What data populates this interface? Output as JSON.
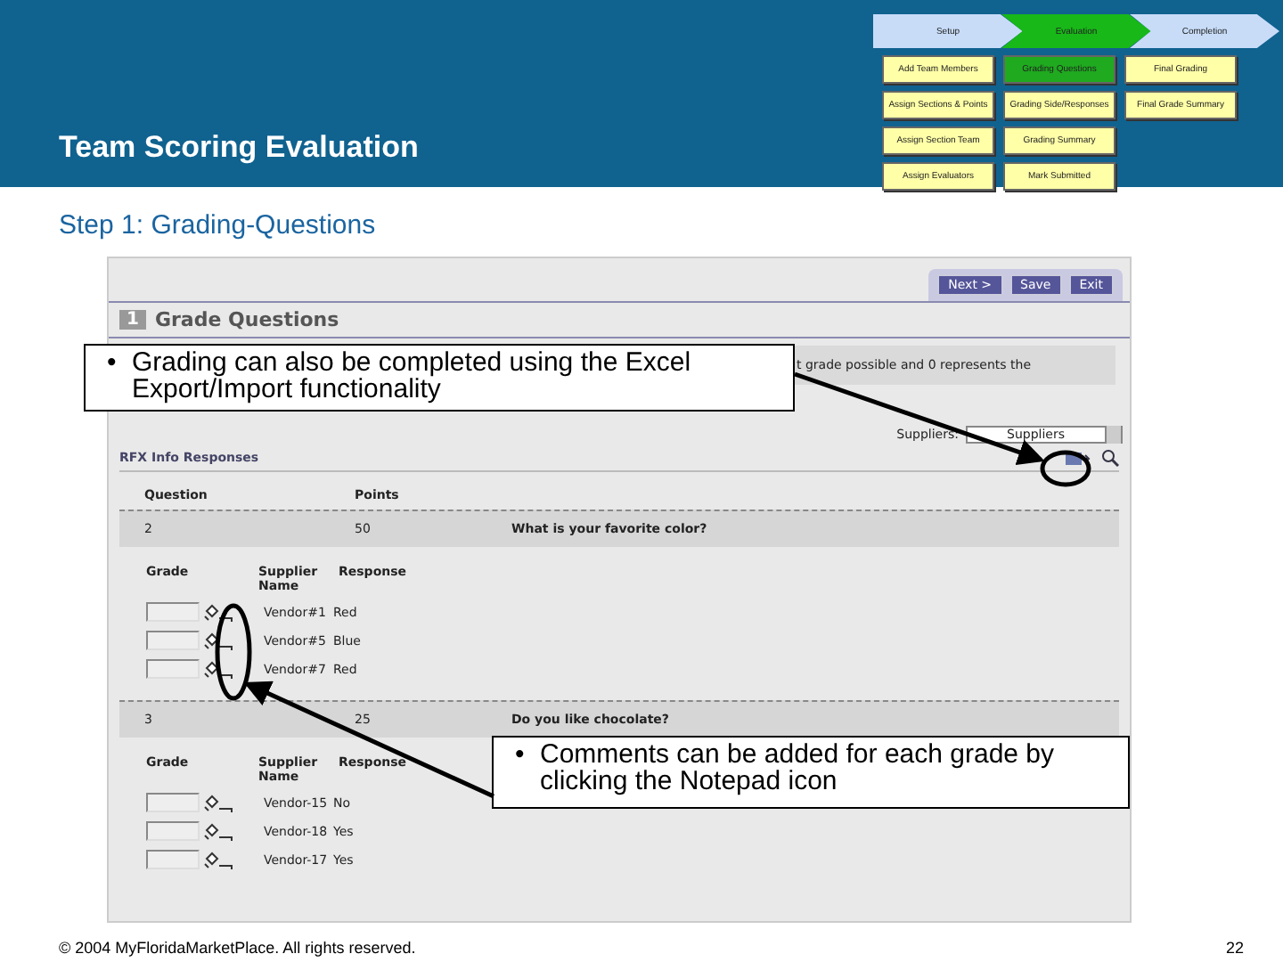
{
  "header": {
    "title": "Team Scoring Evaluation"
  },
  "process": {
    "phases": [
      {
        "label": "Setup",
        "selected": false,
        "steps": [
          {
            "label": "Add Team Members",
            "selected": false
          },
          {
            "label": "Assign Sections & Points",
            "selected": false
          },
          {
            "label": "Assign Section Team",
            "selected": false
          },
          {
            "label": "Assign Evaluators",
            "selected": false
          }
        ]
      },
      {
        "label": "Evaluation",
        "selected": true,
        "steps": [
          {
            "label": "Grading Questions",
            "selected": true
          },
          {
            "label": "Grading Side/Responses",
            "selected": false
          },
          {
            "label": "Grading Summary",
            "selected": false
          },
          {
            "label": "Mark Submitted",
            "selected": false
          }
        ]
      },
      {
        "label": "Completion",
        "selected": false,
        "steps": [
          {
            "label": "Final Grading",
            "selected": false
          },
          {
            "label": "Final Grade Summary",
            "selected": false
          }
        ]
      }
    ]
  },
  "step_title": "Step 1: Grading-Questions",
  "screen": {
    "buttons": [
      "Next >",
      "Save",
      "Exit"
    ],
    "section_number": "1",
    "section_title": "Grade Questions",
    "info": "t grade possible and 0 represents the",
    "filter": {
      "label": "Suppliers:",
      "value": "Suppliers"
    },
    "list_title": "RFX Info Responses",
    "columns": [
      "Question",
      "Points"
    ],
    "questions": [
      {
        "number": "2",
        "points": "50",
        "text": "What is your favorite color?",
        "grade_columns": [
          "Grade",
          "Supplier Name",
          "Response"
        ],
        "responses": [
          {
            "supplier": "Vendor#1",
            "response": "Red"
          },
          {
            "supplier": "Vendor#5",
            "response": "Blue"
          },
          {
            "supplier": "Vendor#7",
            "response": "Red"
          }
        ]
      },
      {
        "number": "3",
        "points": "25",
        "text": "Do you like chocolate?",
        "grade_columns": [
          "Grade",
          "Supplier Name",
          "Response"
        ],
        "responses": [
          {
            "supplier": "Vendor-15",
            "response": "No"
          },
          {
            "supplier": "Vendor-18",
            "response": "Yes"
          },
          {
            "supplier": "Vendor-17",
            "response": "Yes"
          }
        ]
      }
    ]
  },
  "callouts": [
    {
      "bullet": "•",
      "text": "Grading can also be completed using the Excel Export/Import functionality"
    },
    {
      "bullet": "•",
      "text": "Comments can be added for each grade by clicking the Notepad icon"
    }
  ],
  "footer": {
    "copyright": "© 2004 MyFloridaMarketPlace. All rights reserved.",
    "page": "22"
  }
}
